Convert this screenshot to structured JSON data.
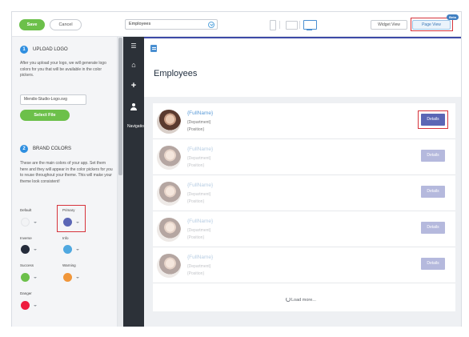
{
  "toolbar": {
    "save_label": "Save",
    "cancel_label": "Cancel",
    "page_select_value": "Employees",
    "widget_view_label": "Widget View",
    "page_view_label": "Page View",
    "beta_badge": "Beta"
  },
  "settings": {
    "upload": {
      "step": "1",
      "title": "UPLOAD LOGO",
      "description": "After you upload your logo, we will generate logo colors for you that will be available in the color pickers.",
      "file_value": "Mendix-Studio-Logo.svg",
      "select_file_label": "Select File"
    },
    "brand": {
      "step": "2",
      "title": "BRAND COLORS",
      "description": "These are the main colors of your app. Set them here and they will appear in the color pickers for you to reuse throughout your theme. This will make your theme look consistent!",
      "colors": [
        {
          "label": "Default",
          "color": "#f2f3f5"
        },
        {
          "label": "Primary",
          "color": "#5b66b5"
        },
        {
          "label": "Inverse",
          "color": "#252c3b"
        },
        {
          "label": "Info",
          "color": "#4fa8e0"
        },
        {
          "label": "Success",
          "color": "#6cc04a"
        },
        {
          "label": "Warning",
          "color": "#f0963a"
        },
        {
          "label": "Danger",
          "color": "#ee1c3e"
        }
      ]
    }
  },
  "nav": {
    "items": [
      {
        "icon": "menu-icon"
      },
      {
        "icon": "home-icon"
      },
      {
        "icon": "plus-icon"
      },
      {
        "icon": "user-icon"
      }
    ],
    "label": "Navigation"
  },
  "main": {
    "title": "Employees",
    "employees": [
      {
        "name": "{FullName}",
        "department": "{Department}",
        "position": "{Position}",
        "button": "Details"
      },
      {
        "name": "{FullName}",
        "department": "{Department}",
        "position": "{Position}",
        "button": "Details"
      },
      {
        "name": "{FullName}",
        "department": "{Department}",
        "position": "{Position}",
        "button": "Details"
      },
      {
        "name": "{FullName}",
        "department": "{Department}",
        "position": "{Position}",
        "button": "Details"
      },
      {
        "name": "{FullName}",
        "department": "{Department}",
        "position": "{Position}",
        "button": "Details"
      }
    ],
    "load_more": "Load more..."
  }
}
